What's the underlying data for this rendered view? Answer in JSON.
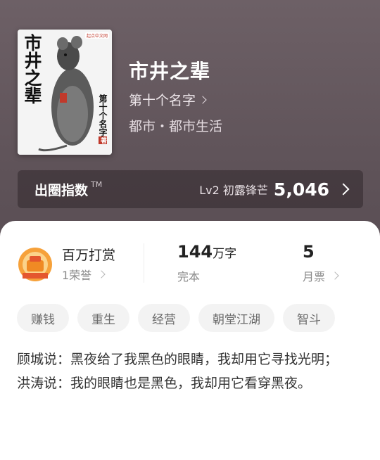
{
  "book": {
    "cover_title": "市井之辈",
    "cover_author": "第十个名字",
    "cover_author_mark": "著",
    "cover_badge": "起点中文网",
    "title": "市井之辈",
    "author": "第十个名字",
    "genre": "都市・都市生活"
  },
  "index_bar": {
    "label": "出圈指数",
    "tm": "TM",
    "level": "Lv2 初露锋芒",
    "value": "5,046"
  },
  "stats": {
    "award_title": "百万打赏",
    "award_sub": "1荣誉",
    "words_num": "144",
    "words_unit": "万字",
    "words_sub": "完本",
    "ticket_num": "5",
    "ticket_sub": "月票"
  },
  "tags": [
    "赚钱",
    "重生",
    "经营",
    "朝堂江湖",
    "智斗"
  ],
  "intro": [
    "顾城说：黑夜给了我黑色的眼睛，我却用它寻找光明；",
    "洪涛说：我的眼睛也是黑色，我却用它看穿黑夜。"
  ],
  "colors": {
    "hero_bg": "#5e5258",
    "tag_bg": "#f3f3f3",
    "award_orange": "#f08a24"
  }
}
